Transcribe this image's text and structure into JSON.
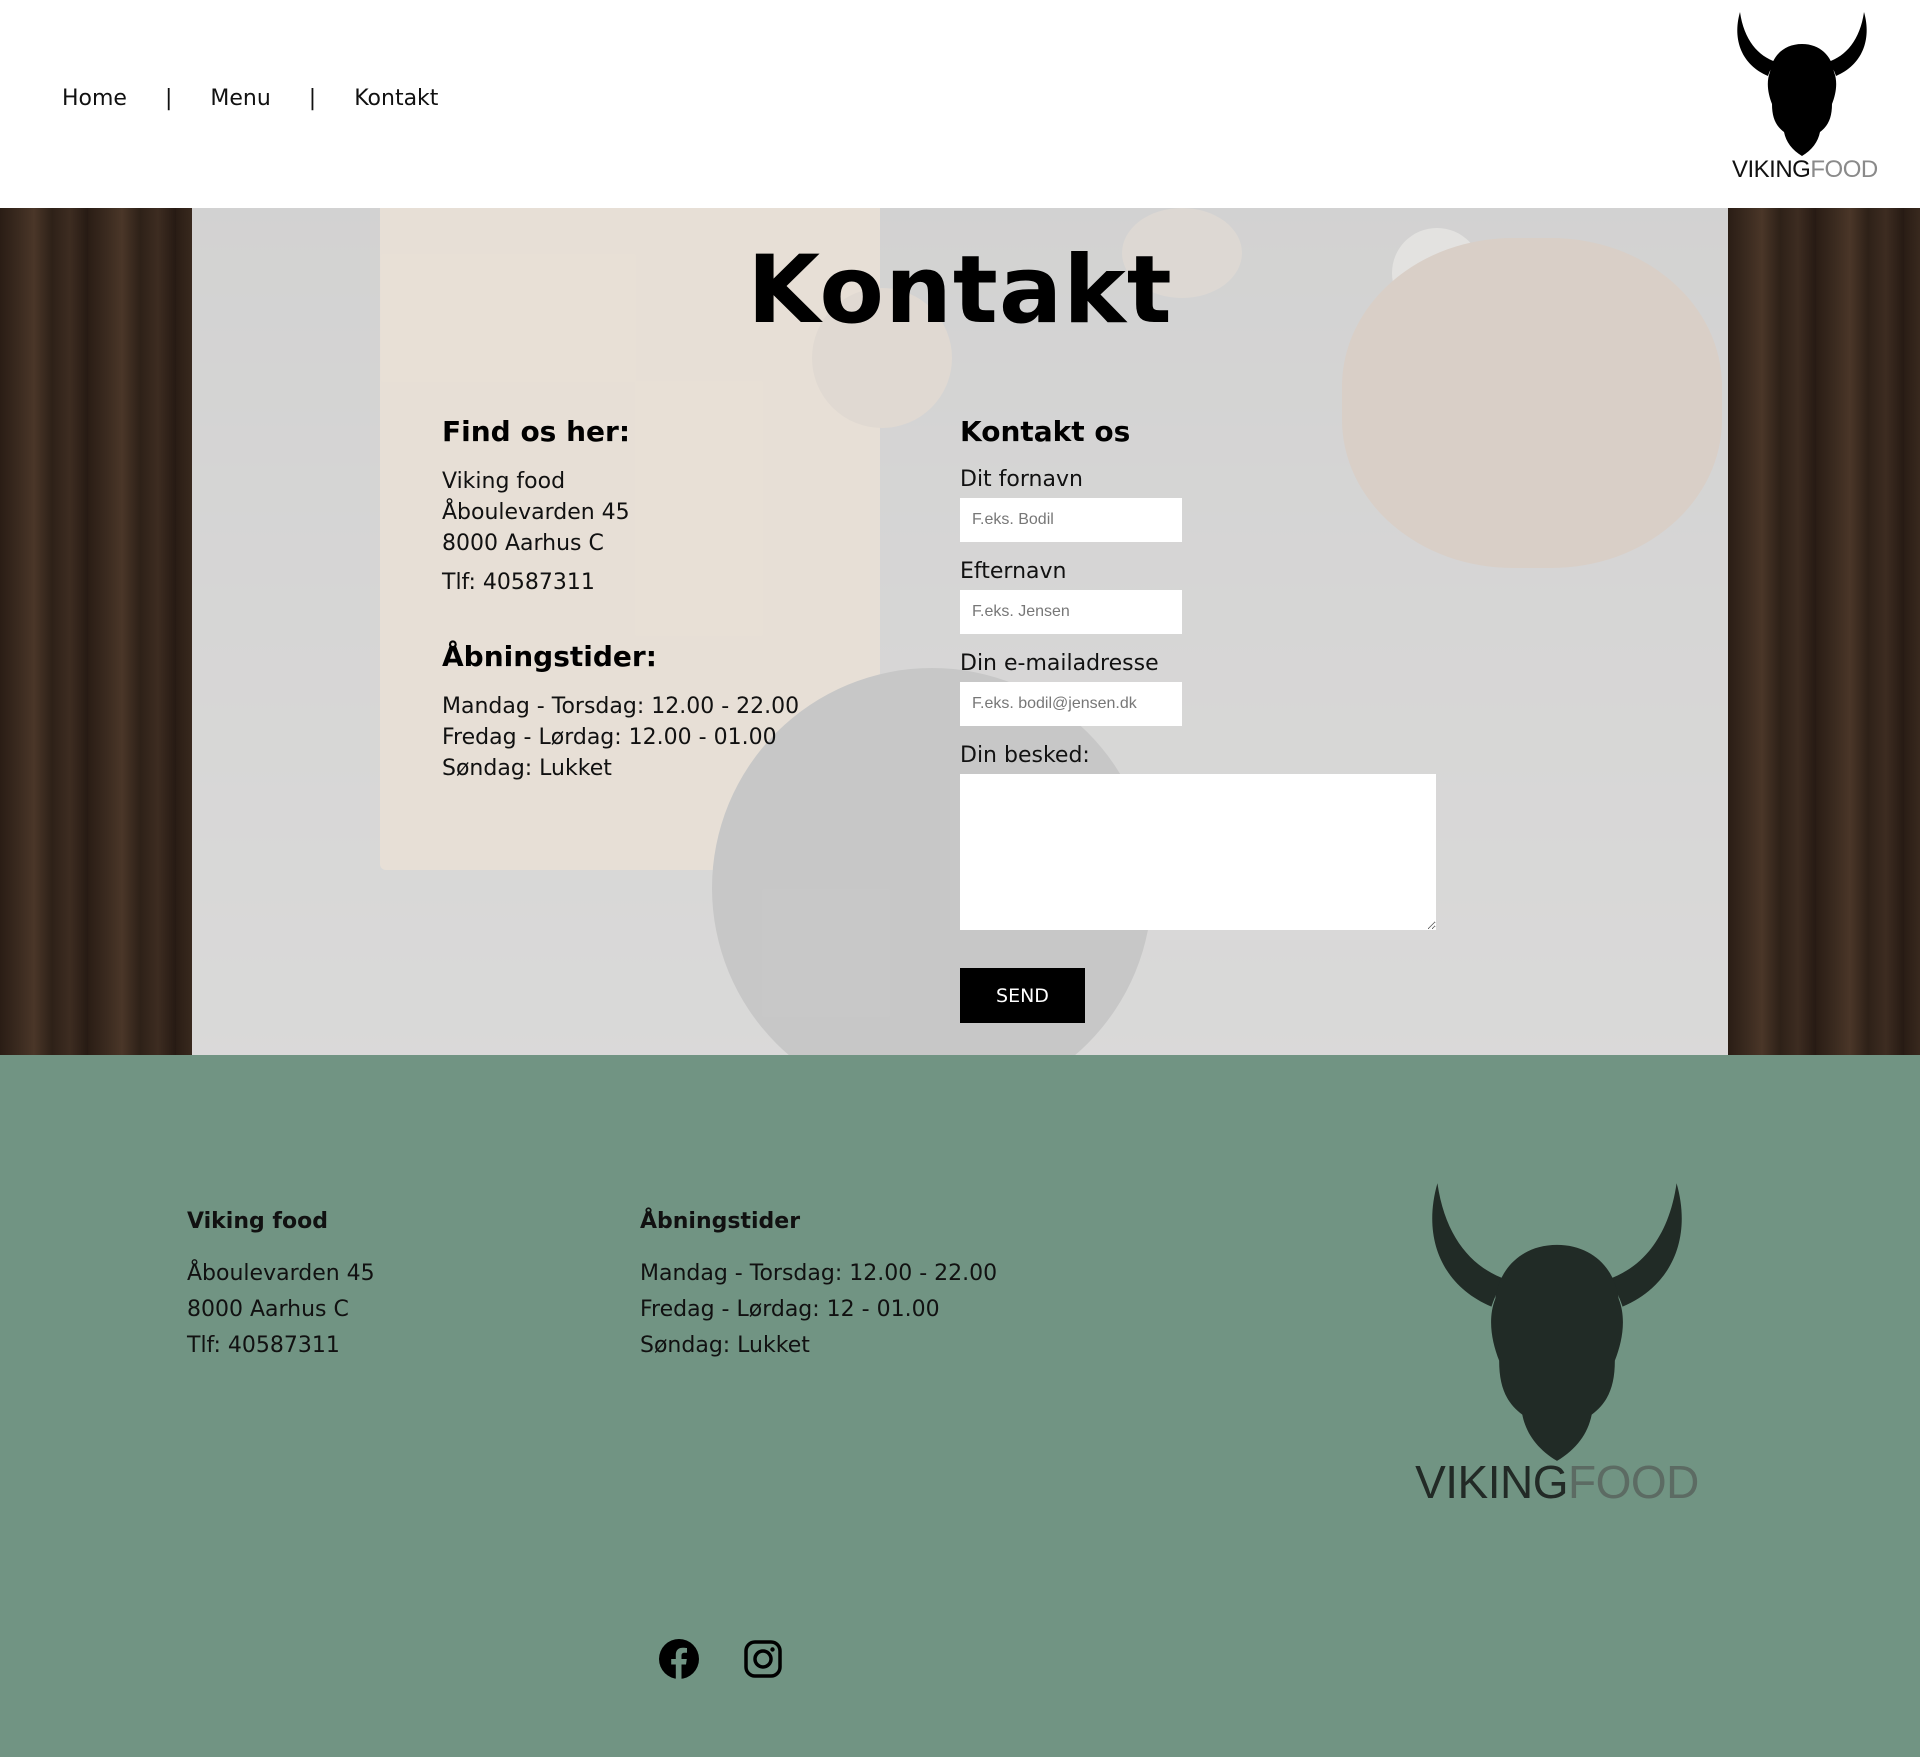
{
  "nav": {
    "items": [
      {
        "label": "Home"
      },
      {
        "label": "Menu"
      },
      {
        "label": "Kontakt"
      }
    ],
    "separator": "|"
  },
  "brand": {
    "part1": "VIKING",
    "part2": "FOOD",
    "logo_icon": "viking-helmet-logo"
  },
  "hero": {
    "title": "Kontakt",
    "find_us": {
      "heading": "Find os her:",
      "address": [
        "Viking food",
        "Åboulevarden 45",
        "8000 Aarhus C"
      ],
      "phone": "Tlf: 40587311"
    },
    "hours": {
      "heading": "Åbningstider:",
      "lines": [
        "Mandag - Torsdag: 12.00 - 22.00",
        "Fredag -  Lørdag: 12.00 - 01.00",
        "Søndag:  Lukket"
      ]
    },
    "form": {
      "heading": "Kontakt os",
      "firstname_label": "Dit fornavn",
      "firstname_placeholder": "F.eks. Bodil",
      "lastname_label": "Efternavn",
      "lastname_placeholder": "F.eks. Jensen",
      "email_label": "Din e-mailadresse",
      "email_placeholder": "F.eks. bodil@jensen.dk",
      "message_label": "Din besked:",
      "send_label": "SEND"
    }
  },
  "footer": {
    "company": {
      "heading": "Viking food",
      "lines": [
        "Åboulevarden 45",
        "8000 Aarhus C",
        "Tlf: 40587311"
      ]
    },
    "hours": {
      "heading": "Åbningstider",
      "lines": [
        "Mandag - Torsdag: 12.00 - 22.00",
        "Fredag -  Lørdag: 12 - 01.00",
        "Søndag:  Lukket"
      ]
    },
    "social": [
      {
        "icon": "facebook-icon"
      },
      {
        "icon": "instagram-icon"
      }
    ],
    "background": "#719483"
  }
}
